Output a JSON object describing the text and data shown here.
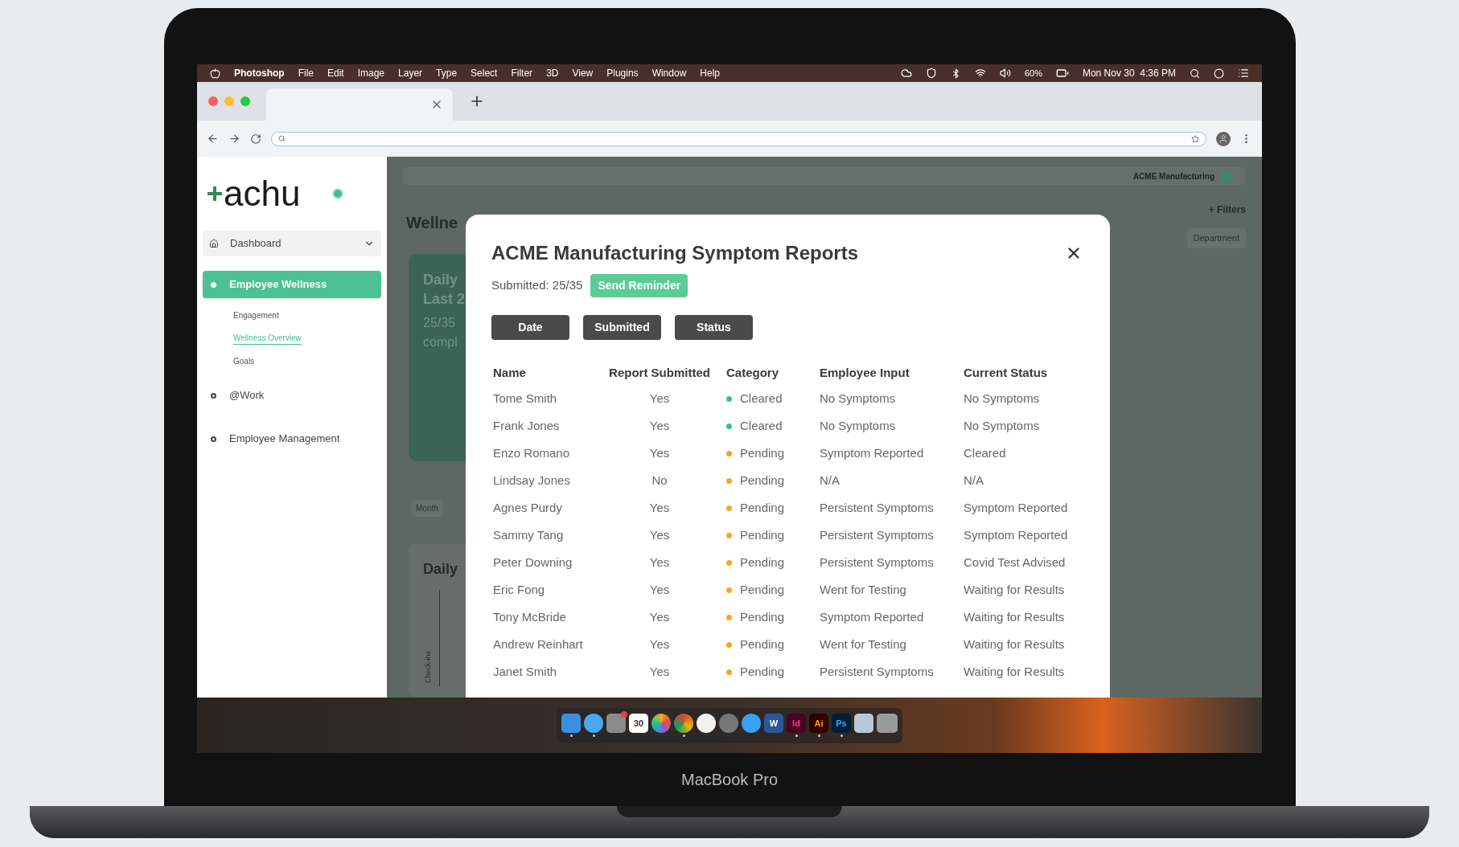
{
  "menu_bar": {
    "app": "Photoshop",
    "menus": [
      "File",
      "Edit",
      "Image",
      "Layer",
      "Type",
      "Select",
      "Filter",
      "3D",
      "View",
      "Plugins",
      "Window",
      "Help"
    ],
    "battery": "60%",
    "clock": "Mon Nov 30  4:36 PM"
  },
  "sidebar": {
    "logo": "achu",
    "nav": [
      {
        "label": "Dashboard",
        "kind": "group",
        "expanded": true
      },
      {
        "label": "Employee Wellness",
        "kind": "item",
        "selected": true,
        "children": [
          {
            "label": "Engagement",
            "selected": false
          },
          {
            "label": "Wellness Overview",
            "selected": true
          },
          {
            "label": "Goals",
            "selected": false
          }
        ]
      },
      {
        "label": "@Work",
        "kind": "item",
        "selected": false
      },
      {
        "label": "Employee Management",
        "kind": "item",
        "selected": false
      }
    ]
  },
  "background": {
    "company": "ACME Manufacturing",
    "heading": "Wellne",
    "card_lines": [
      "Daily",
      "Last 2",
      "25/35",
      "compl"
    ],
    "period": "Month",
    "chart_title": "Daily",
    "axis_label": "Check-ins",
    "filters": "+ Filters",
    "department": "Department"
  },
  "modal": {
    "title": "ACME Manufacturing Symptom Reports",
    "submitted": "Submitted: 25/35",
    "reminder": "Send Reminder",
    "sort_buttons": [
      "Date",
      "Submitted",
      "Status"
    ],
    "columns": [
      "Name",
      "Report Submitted",
      "Category",
      "Employee Input",
      "Current Status"
    ],
    "rows": [
      {
        "name": "Tome Smith",
        "submitted": "Yes",
        "category": "Cleared",
        "color": "#3fbf8a",
        "input": "No Symptoms",
        "status": "No Symptoms"
      },
      {
        "name": "Frank Jones",
        "submitted": "Yes",
        "category": "Cleared",
        "color": "#3fbf8a",
        "input": "No Symptoms",
        "status": "No Symptoms"
      },
      {
        "name": "Enzo Romano",
        "submitted": "Yes",
        "category": "Pending",
        "color": "#f5a623",
        "input": "Symptom Reported",
        "status": "Cleared"
      },
      {
        "name": "Lindsay Jones",
        "submitted": "No",
        "category": "Pending",
        "color": "#f5a623",
        "input": "N/A",
        "status": "N/A"
      },
      {
        "name": "Agnes Purdy",
        "submitted": "Yes",
        "category": "Pending",
        "color": "#f5a623",
        "input": "Persistent Symptoms",
        "status": "Symptom Reported"
      },
      {
        "name": "Sammy Tang",
        "submitted": "Yes",
        "category": "Pending",
        "color": "#f5a623",
        "input": "Persistent Symptoms",
        "status": "Symptom Reported"
      },
      {
        "name": "Peter Downing",
        "submitted": "Yes",
        "category": "Pending",
        "color": "#f5a623",
        "input": "Persistent Symptoms",
        "status": "Covid Test Advised"
      },
      {
        "name": "Eric Fong",
        "submitted": "Yes",
        "category": "Pending",
        "color": "#f5a623",
        "input": "Went for Testing",
        "status": "Waiting for Results"
      },
      {
        "name": "Tony McBride",
        "submitted": "Yes",
        "category": "Pending",
        "color": "#f5a623",
        "input": "Symptom Reported",
        "status": "Waiting for Results"
      },
      {
        "name": "Andrew Reinhart",
        "submitted": "Yes",
        "category": "Pending",
        "color": "#f5a623",
        "input": "Went for Testing",
        "status": "Waiting for Results"
      },
      {
        "name": "Janet Smith",
        "submitted": "Yes",
        "category": "Pending",
        "color": "#f5a623",
        "input": "Persistent Symptoms",
        "status": "Waiting for Results"
      }
    ]
  },
  "dock": [
    {
      "kind": "finder",
      "running": true
    },
    {
      "kind": "messages",
      "running": true
    },
    {
      "kind": "settings",
      "running": false,
      "badge": true
    },
    {
      "kind": "calendar",
      "label": "30",
      "running": false
    },
    {
      "kind": "photos",
      "running": false
    },
    {
      "kind": "chrome",
      "running": true
    },
    {
      "kind": "music",
      "running": false
    },
    {
      "kind": "launchpad",
      "running": false
    },
    {
      "kind": "safari",
      "running": false
    },
    {
      "kind": "word",
      "label": "W",
      "running": false
    },
    {
      "kind": "indesign",
      "label": "Id",
      "running": true
    },
    {
      "kind": "illustrator",
      "label": "Ai",
      "running": true
    },
    {
      "kind": "photoshop",
      "label": "Ps",
      "running": true
    },
    {
      "kind": "preview",
      "running": false
    },
    {
      "kind": "trash",
      "running": false
    }
  ],
  "laptop_label": "MacBook Pro"
}
